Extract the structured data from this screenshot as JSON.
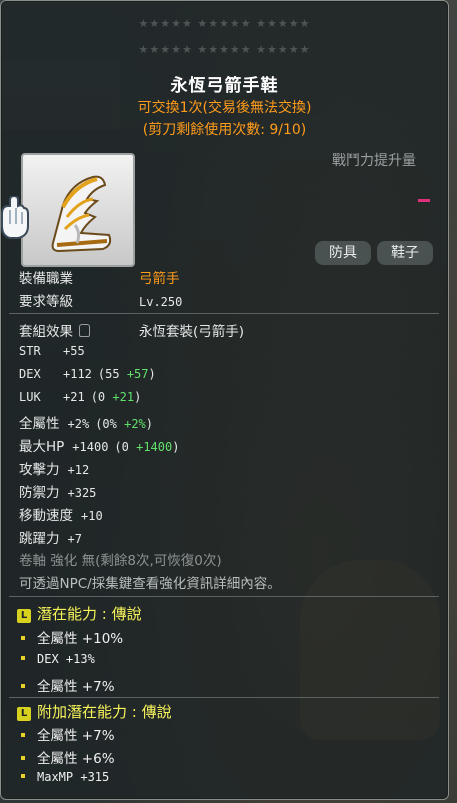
{
  "stars_row1": "★★★★★  ★★★★★  ★★★★★",
  "stars_row2": "★★★★★  ★★★★★  ★★★★★",
  "item": {
    "name": "永恆弓箭手鞋",
    "trade_note": "可交換1次(交易後無法交換)",
    "scissors_note": "(剪刀剩餘使用次數: 9/10)",
    "icon": "boots-icon"
  },
  "combat_power_label": "戰鬥力提升量",
  "tags": [
    "防具",
    "鞋子"
  ],
  "req": {
    "job_label": "裝備職業",
    "job_value": "弓箭手",
    "level_label": "要求等級",
    "level_value": "Lv.250"
  },
  "set": {
    "label": "套組效果",
    "value": "永恆套裝(弓箭手)"
  },
  "stats": [
    {
      "name": "STR",
      "value": "+55",
      "detail": "",
      "bonus": "",
      "close": ""
    },
    {
      "name": "DEX",
      "value": "+112",
      "detail": "(55 ",
      "bonus": "+57",
      "close": ")"
    },
    {
      "name": "LUK",
      "value": "+21",
      "detail": "(0 ",
      "bonus": "+21",
      "close": ")"
    },
    {
      "name": "全屬性",
      "value": "+2%",
      "detail": "(0% ",
      "bonus": "+2%",
      "close": ")"
    },
    {
      "name": "最大HP",
      "value": "+1400",
      "detail": "(0 ",
      "bonus": "+1400",
      "close": ")"
    },
    {
      "name": "攻擊力",
      "value": "+12",
      "detail": "",
      "bonus": "",
      "close": ""
    },
    {
      "name": "防禦力",
      "value": "+325",
      "detail": "",
      "bonus": "",
      "close": ""
    },
    {
      "name": "移動速度",
      "value": "+10",
      "detail": "",
      "bonus": "",
      "close": ""
    },
    {
      "name": "跳躍力",
      "value": "+7",
      "detail": "",
      "bonus": "",
      "close": ""
    }
  ],
  "scroll_note": "卷軸 強化 無(剩餘8次,可恢復0次)",
  "npc_note": "可透過NPC/採集鍵查看強化資訊詳細內容。",
  "potential": {
    "header": "潛在能力 : 傳說",
    "badge": "L",
    "lines": [
      "全屬性 +10%",
      "DEX +13%",
      "全屬性 +7%"
    ]
  },
  "additional_potential": {
    "header": "附加潛在能力 : 傳說",
    "badge": "L",
    "lines": [
      "全屬性 +7%",
      "全屬性 +6%",
      "MaxMP +315"
    ]
  },
  "colors": {
    "orange": "#ff9c1a",
    "green": "#62e06c",
    "potential_yellow": "#f7f35a",
    "panel": "#1c2224"
  }
}
